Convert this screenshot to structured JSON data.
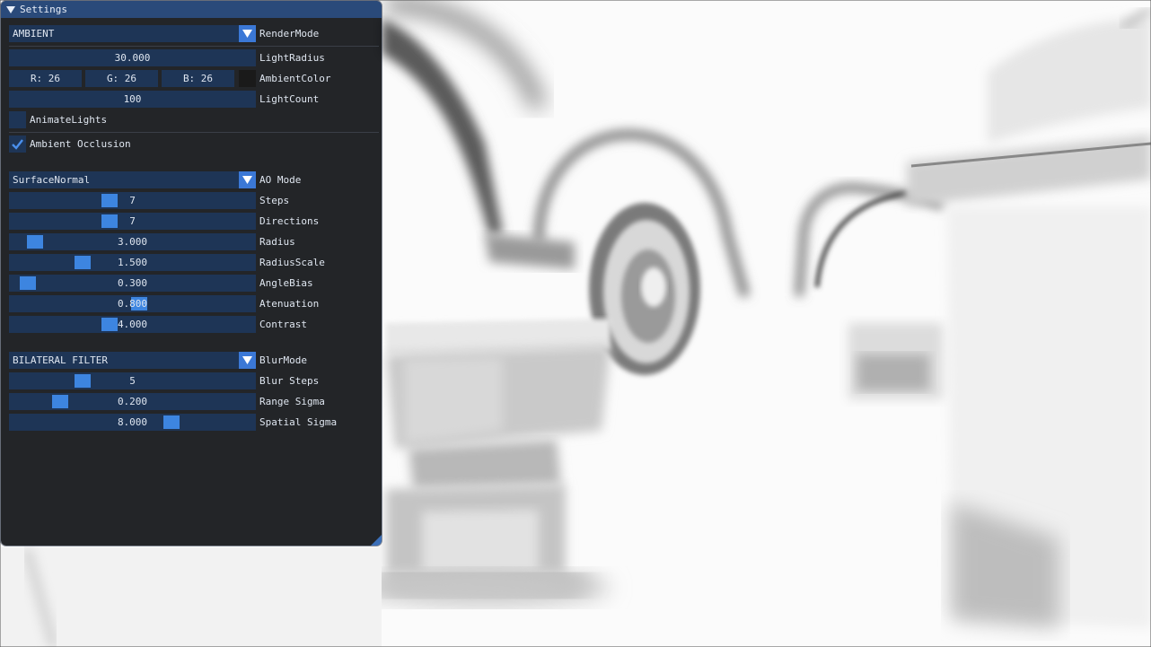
{
  "window": {
    "title": "Settings"
  },
  "render": {
    "mode_value": "AMBIENT",
    "mode_label": "RenderMode",
    "light_radius_value": "30.000",
    "light_radius_label": "LightRadius",
    "ambient": {
      "r": "R: 26",
      "g": "G: 26",
      "b": "B: 26",
      "label": "AmbientColor",
      "swatch_color": "#1a1a1a"
    },
    "light_count_value": "100",
    "light_count_label": "LightCount",
    "animate_lights_label": "AnimateLights",
    "animate_lights_checked": false,
    "ao_enabled_label": "Ambient Occlusion",
    "ao_enabled_checked": true
  },
  "ao": {
    "mode_value": "SurfaceNormal",
    "mode_label": "AO Mode",
    "sliders": [
      {
        "label": "Steps",
        "value": "7",
        "fraction": 0.4
      },
      {
        "label": "Directions",
        "value": "7",
        "fraction": 0.4
      },
      {
        "label": "Radius",
        "value": "3.000",
        "fraction": 0.07
      },
      {
        "label": "RadiusScale",
        "value": "1.500",
        "fraction": 0.28
      },
      {
        "label": "AngleBias",
        "value": "0.300",
        "fraction": 0.04
      },
      {
        "label": "Atenuation",
        "value": "0.800",
        "fraction": 0.53
      },
      {
        "label": "Contrast",
        "value": "4.000",
        "fraction": 0.4
      }
    ]
  },
  "blur": {
    "mode_value": "BILATERAL FILTER",
    "mode_label": "BlurMode",
    "sliders": [
      {
        "label": "Blur Steps",
        "value": "5",
        "fraction": 0.28
      },
      {
        "label": "Range Sigma",
        "value": "0.200",
        "fraction": 0.18
      },
      {
        "label": "Spatial Sigma",
        "value": "8.000",
        "fraction": 0.67
      }
    ]
  },
  "colors": {
    "titlebar": "#2a4a7a",
    "frame": "#1e3556",
    "accent": "#3d85e0",
    "window_bg": "#121418"
  }
}
